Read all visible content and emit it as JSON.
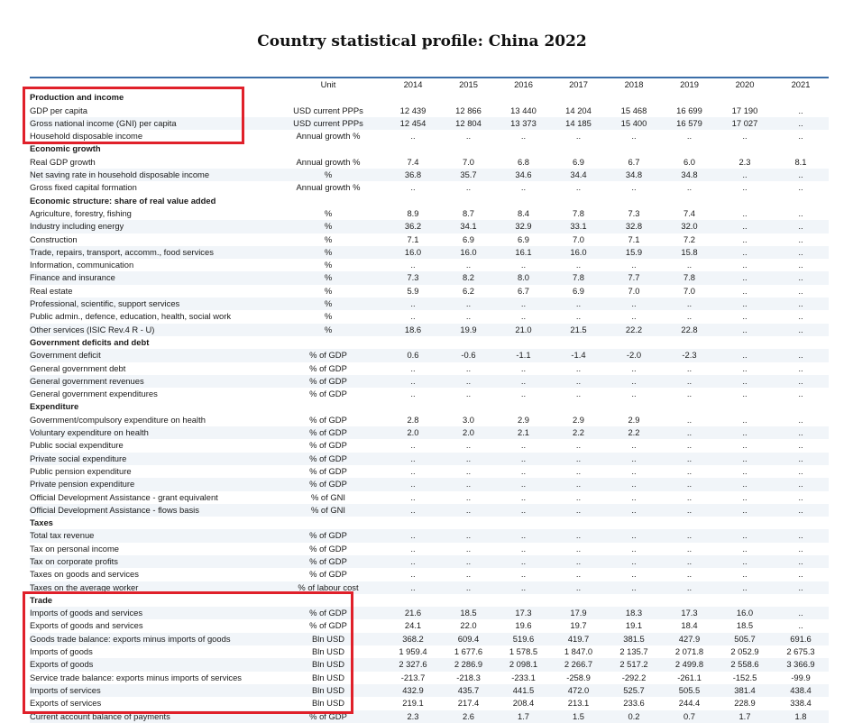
{
  "title": "Country statistical profile: China 2022",
  "columns": {
    "unit": "Unit",
    "years": [
      "2014",
      "2015",
      "2016",
      "2017",
      "2018",
      "2019",
      "2020",
      "2021"
    ]
  },
  "sections": [
    {
      "name": "Production and income",
      "rows": [
        {
          "label": "GDP per capita",
          "unit": "USD current PPPs",
          "values": [
            "12 439",
            "12 866",
            "13 440",
            "14 204",
            "15 468",
            "16 699",
            "17 190",
            ".."
          ]
        },
        {
          "label": "Gross national income (GNI) per capita",
          "unit": "USD current PPPs",
          "values": [
            "12 454",
            "12 804",
            "13 373",
            "14 185",
            "15 400",
            "16 579",
            "17 027",
            ".."
          ]
        },
        {
          "label": "Household disposable income",
          "unit": "Annual growth %",
          "values": [
            "..",
            "..",
            "..",
            "..",
            "..",
            "..",
            "..",
            ".."
          ]
        }
      ]
    },
    {
      "name": "Economic growth",
      "rows": [
        {
          "label": "Real GDP growth",
          "unit": "Annual growth %",
          "values": [
            "7.4",
            "7.0",
            "6.8",
            "6.9",
            "6.7",
            "6.0",
            "2.3",
            "8.1"
          ]
        },
        {
          "label": "Net saving rate in household disposable income",
          "unit": "%",
          "values": [
            "36.8",
            "35.7",
            "34.6",
            "34.4",
            "34.8",
            "34.8",
            "..",
            ".."
          ]
        },
        {
          "label": "Gross fixed capital formation",
          "unit": "Annual growth %",
          "values": [
            "..",
            "..",
            "..",
            "..",
            "..",
            "..",
            "..",
            ".."
          ]
        }
      ]
    },
    {
      "name": "Economic structure: share of real value added",
      "rows": [
        {
          "label": "Agriculture, forestry, fishing",
          "unit": "%",
          "values": [
            "8.9",
            "8.7",
            "8.4",
            "7.8",
            "7.3",
            "7.4",
            "..",
            ".."
          ]
        },
        {
          "label": "Industry including energy",
          "unit": "%",
          "values": [
            "36.2",
            "34.1",
            "32.9",
            "33.1",
            "32.8",
            "32.0",
            "..",
            ".."
          ]
        },
        {
          "label": "Construction",
          "unit": "%",
          "values": [
            "7.1",
            "6.9",
            "6.9",
            "7.0",
            "7.1",
            "7.2",
            "..",
            ".."
          ]
        },
        {
          "label": "Trade, repairs, transport, accomm., food services",
          "unit": "%",
          "values": [
            "16.0",
            "16.0",
            "16.1",
            "16.0",
            "15.9",
            "15.8",
            "..",
            ".."
          ]
        },
        {
          "label": "Information, communication",
          "unit": "%",
          "values": [
            "..",
            "..",
            "..",
            "..",
            "..",
            "..",
            "..",
            ".."
          ]
        },
        {
          "label": "Finance and insurance",
          "unit": "%",
          "values": [
            "7.3",
            "8.2",
            "8.0",
            "7.8",
            "7.7",
            "7.8",
            "..",
            ".."
          ]
        },
        {
          "label": "Real estate",
          "unit": "%",
          "values": [
            "5.9",
            "6.2",
            "6.7",
            "6.9",
            "7.0",
            "7.0",
            "..",
            ".."
          ]
        },
        {
          "label": "Professional, scientific, support services",
          "unit": "%",
          "values": [
            "..",
            "..",
            "..",
            "..",
            "..",
            "..",
            "..",
            ".."
          ]
        },
        {
          "label": "Public admin., defence, education, health, social work",
          "unit": "%",
          "values": [
            "..",
            "..",
            "..",
            "..",
            "..",
            "..",
            "..",
            ".."
          ]
        },
        {
          "label": "Other services (ISIC Rev.4 R - U)",
          "unit": "%",
          "values": [
            "18.6",
            "19.9",
            "21.0",
            "21.5",
            "22.2",
            "22.8",
            "..",
            ".."
          ]
        }
      ]
    },
    {
      "name": "Government deficits and debt",
      "rows": [
        {
          "label": "Government deficit",
          "unit": "% of GDP",
          "values": [
            "0.6",
            "-0.6",
            "-1.1",
            "-1.4",
            "-2.0",
            "-2.3",
            "..",
            ".."
          ]
        },
        {
          "label": "General government debt",
          "unit": "% of GDP",
          "values": [
            "..",
            "..",
            "..",
            "..",
            "..",
            "..",
            "..",
            ".."
          ]
        },
        {
          "label": "General government revenues",
          "unit": "% of GDP",
          "values": [
            "..",
            "..",
            "..",
            "..",
            "..",
            "..",
            "..",
            ".."
          ]
        },
        {
          "label": "General government expenditures",
          "unit": "% of GDP",
          "values": [
            "..",
            "..",
            "..",
            "..",
            "..",
            "..",
            "..",
            ".."
          ]
        }
      ]
    },
    {
      "name": "Expenditure",
      "rows": [
        {
          "label": "Government/compulsory expenditure on health",
          "unit": "% of GDP",
          "values": [
            "2.8",
            "3.0",
            "2.9",
            "2.9",
            "2.9",
            "..",
            "..",
            ".."
          ]
        },
        {
          "label": "Voluntary expenditure on health",
          "unit": "% of GDP",
          "values": [
            "2.0",
            "2.0",
            "2.1",
            "2.2",
            "2.2",
            "..",
            "..",
            ".."
          ]
        },
        {
          "label": "Public social expenditure",
          "unit": "% of GDP",
          "values": [
            "..",
            "..",
            "..",
            "..",
            "..",
            "..",
            "..",
            ".."
          ]
        },
        {
          "label": "Private social expenditure",
          "unit": "% of GDP",
          "values": [
            "..",
            "..",
            "..",
            "..",
            "..",
            "..",
            "..",
            ".."
          ]
        },
        {
          "label": "Public pension expenditure",
          "unit": "% of GDP",
          "values": [
            "..",
            "..",
            "..",
            "..",
            "..",
            "..",
            "..",
            ".."
          ]
        },
        {
          "label": "Private pension expenditure",
          "unit": "% of GDP",
          "values": [
            "..",
            "..",
            "..",
            "..",
            "..",
            "..",
            "..",
            ".."
          ]
        },
        {
          "label": "Official Development Assistance - grant equivalent",
          "unit": "% of GNI",
          "values": [
            "..",
            "..",
            "..",
            "..",
            "..",
            "..",
            "..",
            ".."
          ]
        },
        {
          "label": "Official Development Assistance - flows basis",
          "unit": "% of GNI",
          "values": [
            "..",
            "..",
            "..",
            "..",
            "..",
            "..",
            "..",
            ".."
          ]
        }
      ]
    },
    {
      "name": "Taxes",
      "rows": [
        {
          "label": "Total tax revenue",
          "unit": "% of GDP",
          "values": [
            "..",
            "..",
            "..",
            "..",
            "..",
            "..",
            "..",
            ".."
          ]
        },
        {
          "label": "Tax on personal income",
          "unit": "% of GDP",
          "values": [
            "..",
            "..",
            "..",
            "..",
            "..",
            "..",
            "..",
            ".."
          ]
        },
        {
          "label": "Tax on corporate profits",
          "unit": "% of GDP",
          "values": [
            "..",
            "..",
            "..",
            "..",
            "..",
            "..",
            "..",
            ".."
          ]
        },
        {
          "label": "Taxes on goods and services",
          "unit": "% of GDP",
          "values": [
            "..",
            "..",
            "..",
            "..",
            "..",
            "..",
            "..",
            ".."
          ]
        },
        {
          "label": "Taxes on the average worker",
          "unit": "% of labour cost",
          "values": [
            "..",
            "..",
            "..",
            "..",
            "..",
            "..",
            "..",
            ".."
          ]
        }
      ]
    },
    {
      "name": "Trade",
      "rows": [
        {
          "label": "Imports of goods and services",
          "unit": "% of GDP",
          "values": [
            "21.6",
            "18.5",
            "17.3",
            "17.9",
            "18.3",
            "17.3",
            "16.0",
            ".."
          ]
        },
        {
          "label": "Exports of goods and services",
          "unit": "% of GDP",
          "values": [
            "24.1",
            "22.0",
            "19.6",
            "19.7",
            "19.1",
            "18.4",
            "18.5",
            ".."
          ]
        },
        {
          "label": "Goods trade balance: exports minus imports of goods",
          "unit": "Bln USD",
          "values": [
            "368.2",
            "609.4",
            "519.6",
            "419.7",
            "381.5",
            "427.9",
            "505.7",
            "691.6"
          ]
        },
        {
          "label": "Imports of goods",
          "unit": "Bln USD",
          "values": [
            "1 959.4",
            "1 677.6",
            "1 578.5",
            "1 847.0",
            "2 135.7",
            "2 071.8",
            "2 052.9",
            "2 675.3"
          ]
        },
        {
          "label": "Exports of goods",
          "unit": "Bln USD",
          "values": [
            "2 327.6",
            "2 286.9",
            "2 098.1",
            "2 266.7",
            "2 517.2",
            "2 499.8",
            "2 558.6",
            "3 366.9"
          ]
        },
        {
          "label": "Service trade balance: exports minus imports of services",
          "unit": "Bln USD",
          "values": [
            "-213.7",
            "-218.3",
            "-233.1",
            "-258.9",
            "-292.2",
            "-261.1",
            "-152.5",
            "-99.9"
          ]
        },
        {
          "label": "Imports of services",
          "unit": "Bln USD",
          "values": [
            "432.9",
            "435.7",
            "441.5",
            "472.0",
            "525.7",
            "505.5",
            "381.4",
            "438.4"
          ]
        },
        {
          "label": "Exports of services",
          "unit": "Bln USD",
          "values": [
            "219.1",
            "217.4",
            "208.4",
            "213.1",
            "233.6",
            "244.4",
            "228.9",
            "338.4"
          ]
        },
        {
          "label": "Current account balance of payments",
          "unit": "% of GDP",
          "values": [
            "2.3",
            "2.6",
            "1.7",
            "1.5",
            "0.2",
            "0.7",
            "1.7",
            "1.8"
          ]
        }
      ]
    }
  ]
}
